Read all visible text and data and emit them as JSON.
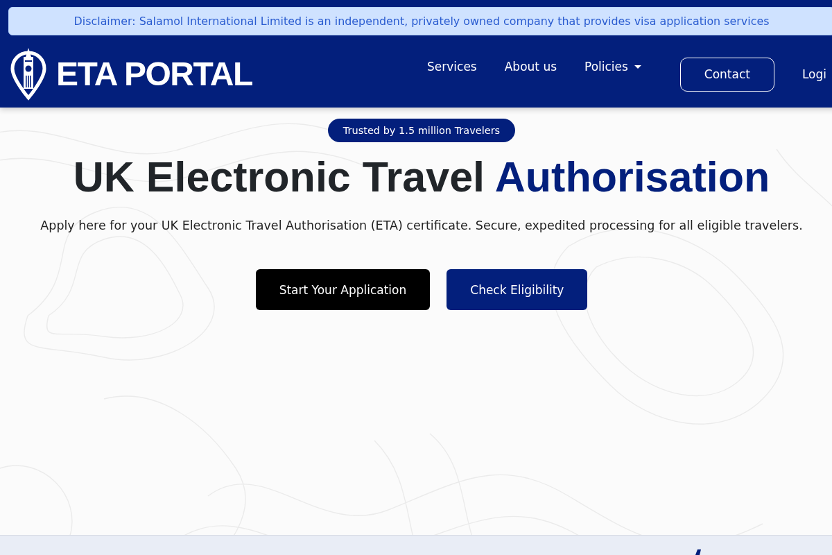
{
  "disclaimer": {
    "text": "Disclaimer: Salamol International Limited is an independent, privately owned company that provides visa application services"
  },
  "navbar": {
    "logo": {
      "text": "ETA PORTAL"
    },
    "links": [
      {
        "label": "Services",
        "kind": "link"
      },
      {
        "label": "About us",
        "kind": "link"
      },
      {
        "label": "Policies",
        "kind": "dropdown"
      }
    ],
    "contact_button": {
      "label": "Contact"
    },
    "login_link": {
      "label": "Logi"
    }
  },
  "hero": {
    "badge": "Trusted by 1.5 million Travelers",
    "title": {
      "lead": "UK Electronic Travel",
      "accent": "Authorisation"
    },
    "subtitle": "Apply here for your UK Electronic Travel Authorisation (ETA) certificate. Secure, expedited processing for all eligible travelers.",
    "buttons": [
      {
        "label": "Start Your Application",
        "kind": "primary"
      },
      {
        "label": "Check Eligibility",
        "kind": "secondary"
      }
    ]
  }
}
